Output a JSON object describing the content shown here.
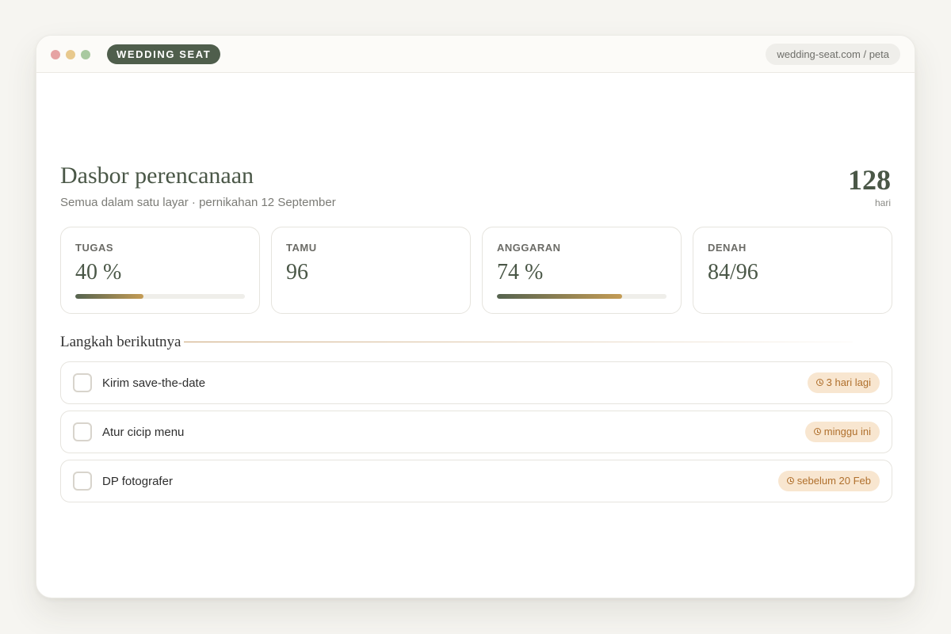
{
  "app": {
    "brand": "WEDDING SEAT",
    "url": "wedding-seat.com / peta"
  },
  "header": {
    "title": "Dasbor perencanaan",
    "subtitle": "Semua dalam satu layar · pernikahan 12 September",
    "countdown_value": "128",
    "countdown_unit": "hari"
  },
  "stats": [
    {
      "label": "TUGAS",
      "value": "40 %",
      "progress": 0.4
    },
    {
      "label": "TAMU",
      "value": "96"
    },
    {
      "label": "ANGGARAN",
      "value": "74 %",
      "progress": 0.74
    },
    {
      "label": "DENAH",
      "value": "84/96"
    }
  ],
  "section": {
    "title": "Langkah berikutnya"
  },
  "tasks": [
    {
      "label": "Kirim save-the-date",
      "due": "3 hari lagi",
      "checked": false
    },
    {
      "label": "Atur cicip menu",
      "due": "minggu ini",
      "checked": false
    },
    {
      "label": "DP fotografer",
      "due": "sebelum 20 Feb",
      "checked": false
    }
  ],
  "colors": {
    "brand": "#4f5e4c",
    "accent": "#c49c55",
    "due_badge_bg": "#f8e6d0",
    "due_badge_text": "#b0702d"
  },
  "icons": [
    "close-dot-icon",
    "minimize-dot-icon",
    "maximize-dot-icon",
    "clock-icon"
  ]
}
